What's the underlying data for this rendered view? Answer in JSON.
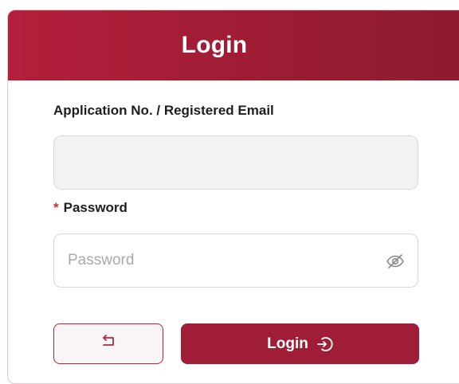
{
  "header": {
    "title": "Login"
  },
  "form": {
    "application_label": "Application No. / Registered Email",
    "application_value": "",
    "password_required_marker": "*",
    "password_label": "Password",
    "password_placeholder": "Password",
    "password_value": ""
  },
  "buttons": {
    "back_icon": "return-icon",
    "login_label": "Login",
    "login_icon": "login-enter-icon"
  },
  "colors": {
    "brand": "#9f1d36",
    "required": "#d12b2b"
  }
}
